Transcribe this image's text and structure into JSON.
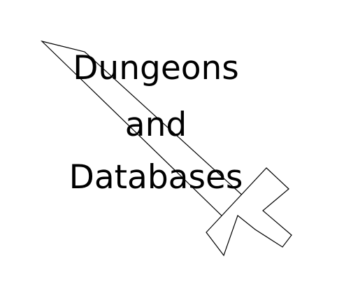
{
  "title": {
    "lines": [
      "Dungeons",
      "and",
      "Databases"
    ]
  },
  "graphic": {
    "icon": "sword-icon",
    "stroke_color": "#000000",
    "fill_color": "#ffffff"
  },
  "background_color": "#ffffff"
}
